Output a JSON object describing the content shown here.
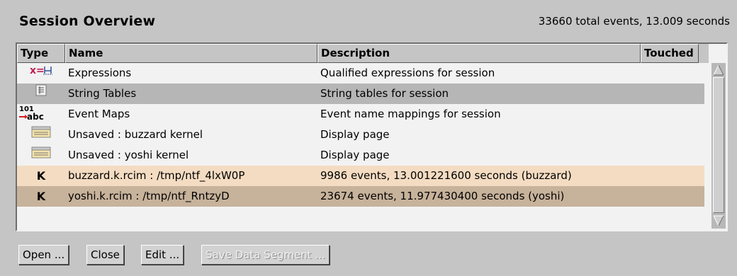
{
  "panel": {
    "title": "Session Overview",
    "stats": "33660 total events, 13.009 seconds"
  },
  "table": {
    "headers": [
      "Type",
      "Name",
      "Description",
      "Touched"
    ],
    "rows": [
      {
        "icon": "expressions-icon",
        "name": "Expressions",
        "description": "Qualified expressions for session",
        "touched": "",
        "color": "#f2f2f2"
      },
      {
        "icon": "string-table-icon",
        "name": "String Tables",
        "description": "String tables for session",
        "touched": "",
        "color": "#b6b6b6"
      },
      {
        "icon": "event-map-icon",
        "name": "Event Maps",
        "description": "Event name mappings for session",
        "touched": "",
        "color": "#f2f2f2"
      },
      {
        "icon": "display-page-icon",
        "name": "Unsaved : buzzard kernel",
        "description": "Display page",
        "touched": "",
        "color": "#f2f2f2"
      },
      {
        "icon": "display-page-icon",
        "name": "Unsaved : yoshi kernel",
        "description": "Display page",
        "touched": "",
        "color": "#f2f2f2"
      },
      {
        "icon": "kernel-icon",
        "icon_text": "K",
        "name": "buzzard.k.rcim : /tmp/ntf_4lxW0P",
        "description": "9986 events, 13.001221600 seconds  (buzzard)",
        "touched": "",
        "color": "#f4dcc2"
      },
      {
        "icon": "kernel-icon",
        "icon_text": "K",
        "name": "yoshi.k.rcim : /tmp/ntf_RntzyD",
        "description": "23674 events, 11.977430400 seconds  (yoshi)",
        "touched": "",
        "color": "#c7b29b"
      }
    ]
  },
  "buttons": {
    "open": "Open ...",
    "close": "Close",
    "edit": "Edit ...",
    "save_segment": "Save Data Segment ..."
  },
  "icons": {
    "expr_text": "x=",
    "event_map_top": "101",
    "event_map_bottom": "abc"
  }
}
